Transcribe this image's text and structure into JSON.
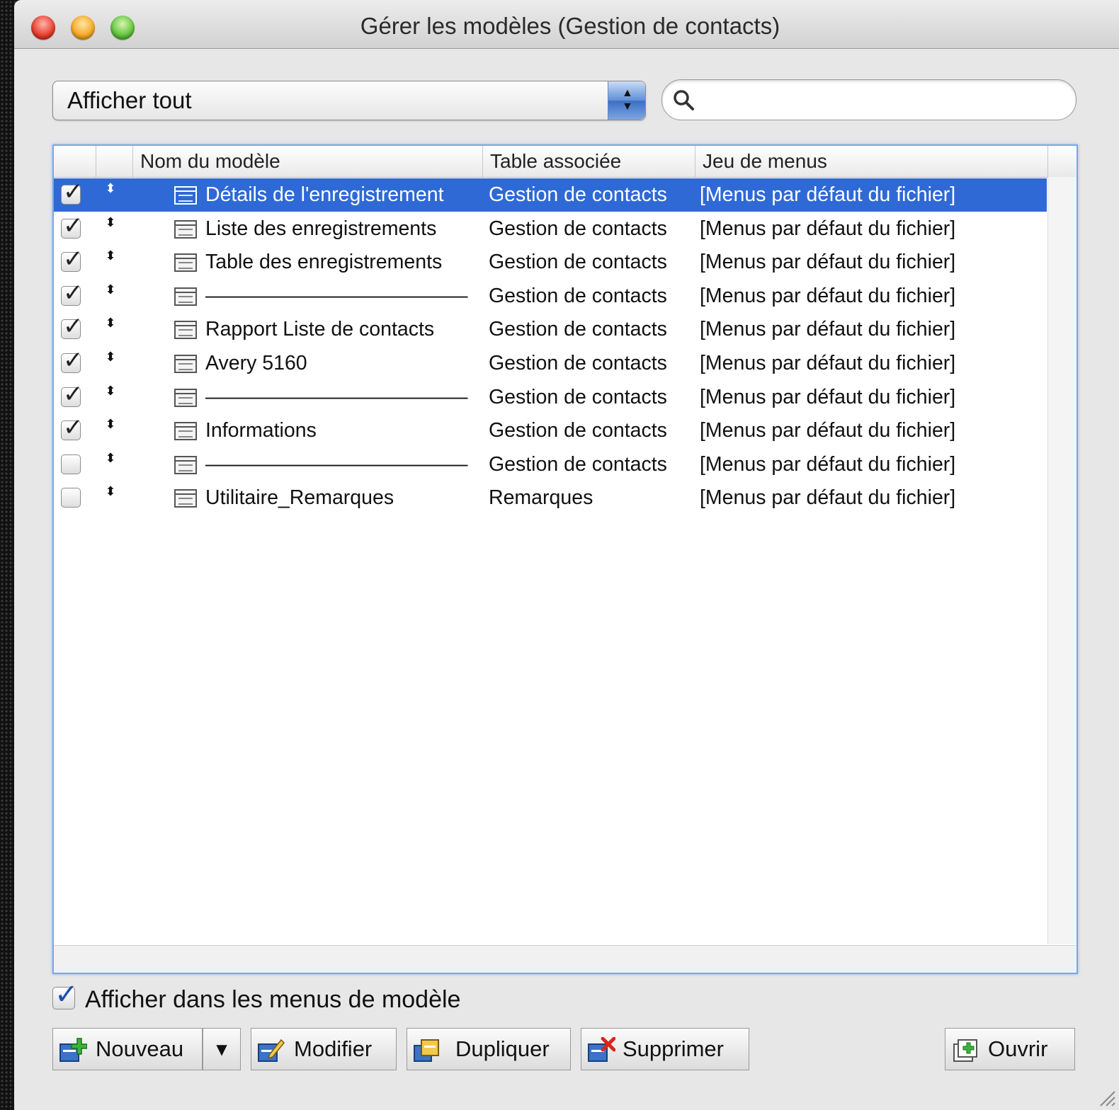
{
  "window": {
    "title": "Gérer les modèles (Gestion de contacts)"
  },
  "filter": {
    "selected": "Afficher tout"
  },
  "search": {
    "placeholder": "",
    "value": ""
  },
  "table": {
    "headers": {
      "name": "Nom du modèle",
      "table": "Table associée",
      "menus": "Jeu de menus"
    },
    "rows": [
      {
        "checked": true,
        "name": "Détails de l'enregistrement",
        "table": "Gestion de contacts",
        "menus": "[Menus par défaut du fichier]"
      },
      {
        "checked": true,
        "name": "Liste des enregistrements",
        "table": "Gestion de contacts",
        "menus": "[Menus par défaut du fichier]"
      },
      {
        "checked": true,
        "name": "Table des enregistrements",
        "table": "Gestion de contacts",
        "menus": "[Menus par défaut du fichier]"
      },
      {
        "checked": true,
        "name": "—————————————",
        "table": "Gestion de contacts",
        "menus": "[Menus par défaut du fichier]"
      },
      {
        "checked": true,
        "name": "Rapport Liste de contacts",
        "table": "Gestion de contacts",
        "menus": "[Menus par défaut du fichier]"
      },
      {
        "checked": true,
        "name": "Avery 5160",
        "table": "Gestion de contacts",
        "menus": "[Menus par défaut du fichier]"
      },
      {
        "checked": true,
        "name": "—————————————",
        "table": "Gestion de contacts",
        "menus": "[Menus par défaut du fichier]"
      },
      {
        "checked": true,
        "name": "Informations",
        "table": "Gestion de contacts",
        "menus": "[Menus par défaut du fichier]"
      },
      {
        "checked": false,
        "name": "—————————————",
        "table": "Gestion de contacts",
        "menus": "[Menus par défaut du fichier]"
      },
      {
        "checked": false,
        "name": "Utilitaire_Remarques",
        "table": "Remarques",
        "menus": "[Menus par défaut du fichier]"
      }
    ],
    "selected_index": 0
  },
  "show_in_menus": {
    "checked": true,
    "label": "Afficher dans les menus de modèle"
  },
  "buttons": {
    "new": "Nouveau",
    "new_menu": "▾",
    "edit": "Modifier",
    "duplicate": "Dupliquer",
    "delete": "Supprimer",
    "open": "Ouvrir"
  },
  "icons": {
    "checkmark": "✓",
    "reorder": "⬍"
  },
  "colors": {
    "selection": "#2f69d6",
    "focus_ring": "#7aa7e8"
  }
}
